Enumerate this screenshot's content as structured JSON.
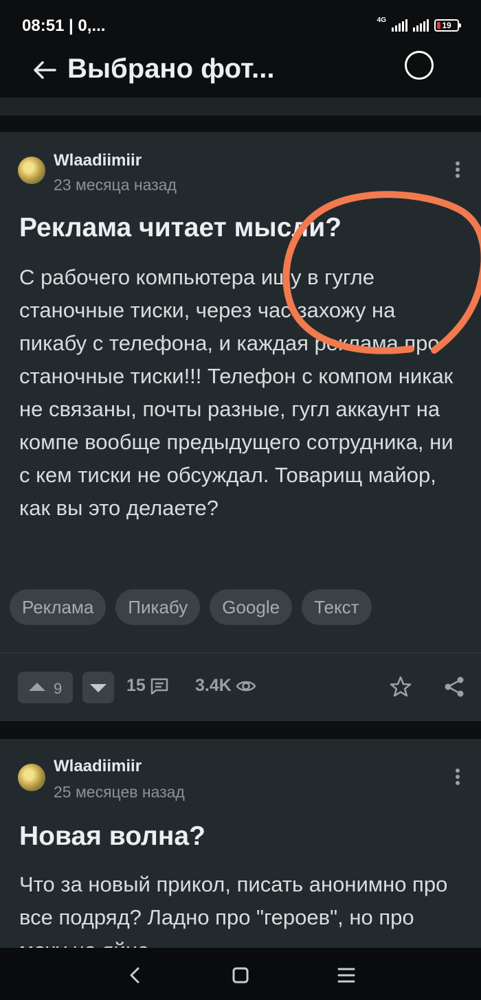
{
  "status": {
    "time": "08:51 | 0,...",
    "network": "4G",
    "battery": "19",
    "battery_color": "#e53935"
  },
  "header": {
    "back_icon": "arrow-left-icon",
    "title": "Выбрано фот...",
    "select_icon": "circle-select-icon"
  },
  "posts": [
    {
      "author": "Wlaadiimiir",
      "time": "23 месяца назад",
      "title": "Реклама читает мысли?",
      "body": "С рабочего компьютера ищу в гугле станочные тиски, через час захожу на пикабу с телефона, и каждая реклама про станочные тиски!!! Телефон с компом никак не связаны, почты разные, гугл аккаунт на компе вообще предыдущего сотрудника, ни с кем тиски не обсуждал. Товарищ майор, как вы это делаете?",
      "tags": [
        "Реклама",
        "Пикабу",
        "Google",
        "Текст"
      ],
      "votes": "9",
      "comments": "15",
      "views": "3.4K"
    },
    {
      "author": "Wlaadiimiir",
      "time": "25 месяцев назад",
      "title": "Новая волна?",
      "body": "Что за новый прикол, писать анонимно про все подряд? Ладно про \"героев\", но про мечу на яйне"
    }
  ],
  "annotation": {
    "color": "#f27a4e"
  },
  "navbar": {
    "back_icon": "nav-back-icon",
    "home_icon": "nav-home-icon",
    "menu_icon": "nav-recents-icon"
  }
}
